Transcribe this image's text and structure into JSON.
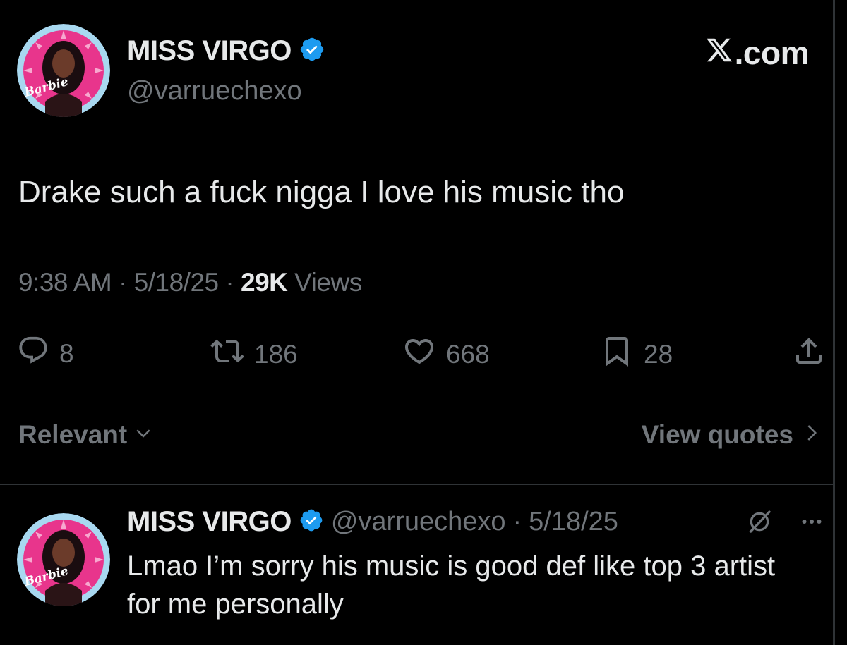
{
  "tweet": {
    "author": {
      "display_name": "MISS VIRGO",
      "handle": "@varruechexo",
      "avatar_label": "Barbie"
    },
    "brand": ".com",
    "text": "Drake such a fuck nigga I love his music tho",
    "time": "9:38 AM",
    "date": "5/18/25",
    "views_count": "29K",
    "views_label": "Views",
    "separator": "·",
    "stats": {
      "replies": "8",
      "retweets": "186",
      "likes": "668",
      "bookmarks": "28"
    }
  },
  "replies_bar": {
    "sort_label": "Relevant",
    "view_quotes_label": "View quotes"
  },
  "reply": {
    "author": {
      "display_name": "MISS VIRGO",
      "handle": "@varruechexo",
      "avatar_label": "Barbie"
    },
    "separator": "·",
    "date": "5/18/25",
    "text": "Lmao I’m sorry his music is good def like top 3 artist for me personally"
  },
  "icons": {
    "verified": "verified-badge-icon",
    "x_logo": "x-logo-icon",
    "reply": "reply-icon",
    "retweet": "retweet-icon",
    "like": "heart-icon",
    "bookmark": "bookmark-icon",
    "share": "share-icon",
    "chevron_down": "chevron-down-icon",
    "chevron_right": "chevron-right-icon",
    "grok": "grok-icon",
    "more": "more-icon"
  },
  "colors": {
    "background": "#000000",
    "primary_text": "#e7e9ea",
    "secondary_text": "#71767b",
    "verified_blue": "#1d9bf0",
    "divider": "#2f3336",
    "avatar_ring": "#a8d8f0",
    "avatar_pink": "#e8358c"
  }
}
